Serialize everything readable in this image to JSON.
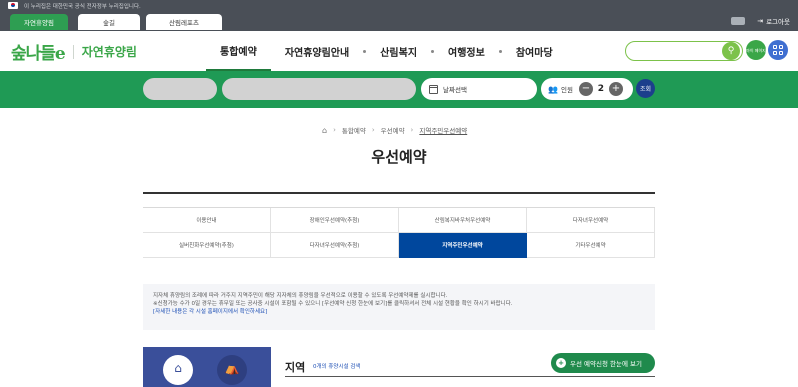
{
  "gov_banner": {
    "text": "이 누리집은 대한민국 공식 전자정부 누리집입니다."
  },
  "site_tabs": [
    "자연휴양림",
    "숲길",
    "산림레포츠"
  ],
  "logout": {
    "label": "로그아웃"
  },
  "logo": {
    "mark": "숲나들e",
    "text": "자연휴양림"
  },
  "gnb": [
    "통합예약",
    "자연휴양림안내",
    "산림복지",
    "여행정보",
    "참여마당"
  ],
  "util": {
    "label1": "마이\n페이지"
  },
  "booking": {
    "date_label": "날짜선택",
    "people_label": "인원",
    "count": "2",
    "search_label": "조회"
  },
  "breadcrumb": [
    "통합예약",
    "우선예약",
    "지역주민우선예약"
  ],
  "page_title": "우선예약",
  "subtabs": [
    "이용안내",
    "장애인우선예약(추첨)",
    "산림복지바우처우선예약",
    "다자녀우선예약",
    "실버친화우선예약(추첨)",
    "다자녀우선예약(추첨)",
    "지역주민우선예약",
    "기타우선예약"
  ],
  "notice": {
    "line1": "지자체 휴양림의 조례에 따라 거주지 지역주민이 해당 지자체의 휴양림을 우선적으로 이용할 수 있도록 우선예약제를 실시합니다.",
    "line2": "※신청가능 수가 0일 경우는 휴무일 또는 공사중 시설이 포함될 수 있으니 [우선예약 신청 한눈에 보기]를 클릭하셔서 전체 시설 현황을 확인 하시기 바랍니다.",
    "link": "[자세한 내용은 각 시설 홈페이지에서 확인하세요]"
  },
  "region": {
    "title": "지역",
    "count": "0개의 휴양시설 검색",
    "button": "우선 예약신청 한눈에 보기"
  },
  "side": {
    "item1": "휴양",
    "item2": "야영"
  },
  "colors": {
    "brand_green": "#1f9a55",
    "active_blue": "#00479d",
    "dark_bar": "#4a4f57"
  }
}
